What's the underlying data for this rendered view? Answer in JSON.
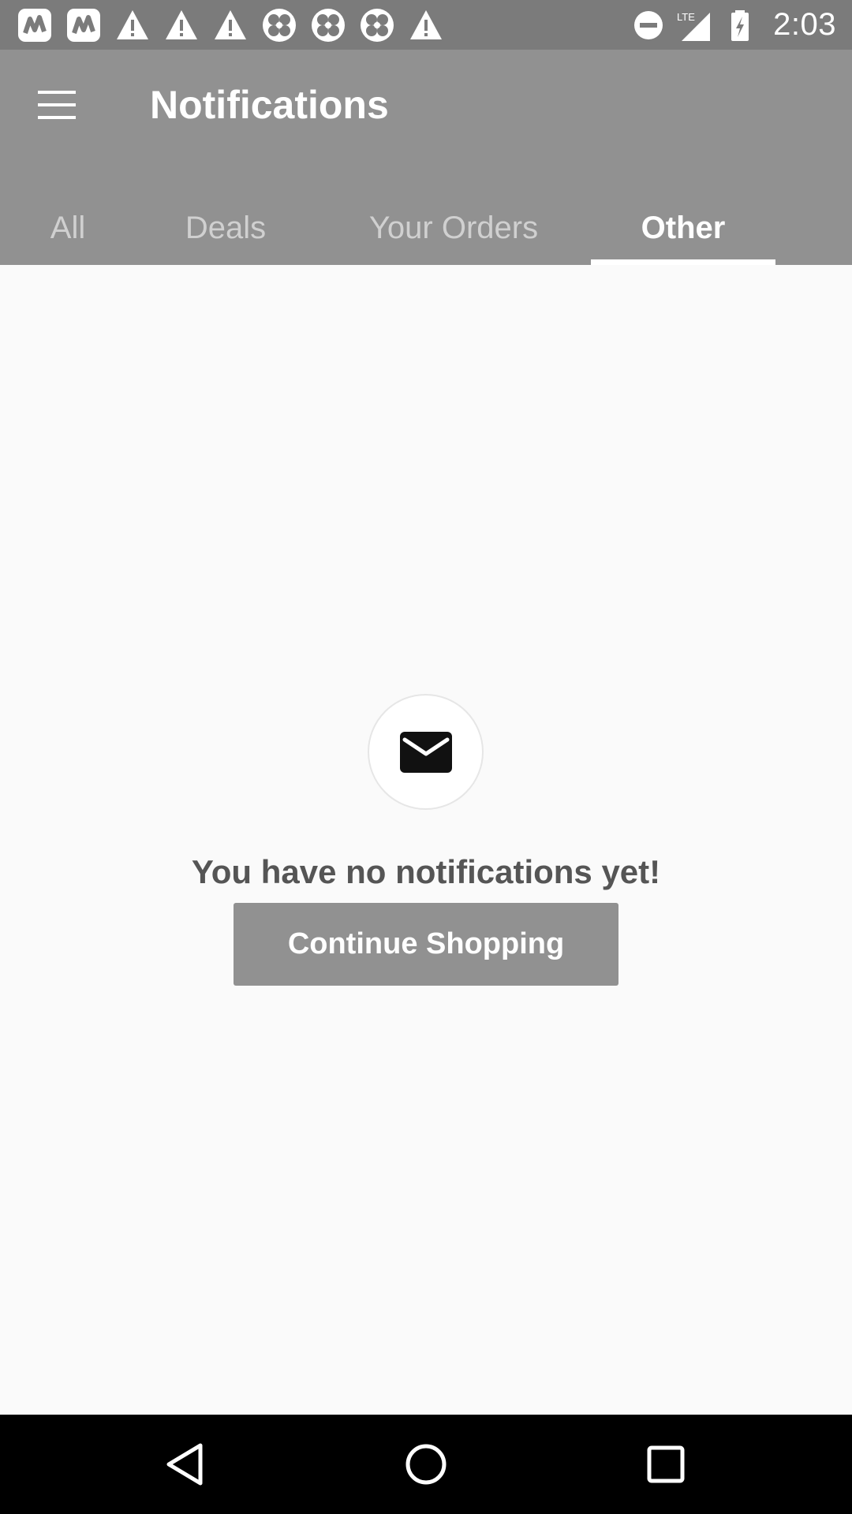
{
  "status_bar": {
    "left_icons": [
      "notification-app-icon",
      "notification-app-icon",
      "warning-icon",
      "warning-icon",
      "warning-icon",
      "clover-icon",
      "clover-icon",
      "clover-icon",
      "warning-icon"
    ],
    "right_icons": [
      "do-not-disturb-icon",
      "lte-signal-icon",
      "battery-charging-icon"
    ],
    "lte_label": "LTE",
    "time": "2:03"
  },
  "app_bar": {
    "menu_icon": "hamburger-menu-icon",
    "title": "Notifications",
    "background_color": "#919191"
  },
  "tabs": [
    {
      "label": "All",
      "active": false
    },
    {
      "label": "Deals",
      "active": false
    },
    {
      "label": "Your Orders",
      "active": false
    },
    {
      "label": "Other",
      "active": true
    }
  ],
  "empty_state": {
    "icon": "envelope-icon",
    "message": "You have no notifications yet!",
    "button_label": "Continue Shopping"
  },
  "nav_bar": {
    "buttons": [
      "back-icon",
      "home-icon",
      "recents-icon"
    ]
  }
}
